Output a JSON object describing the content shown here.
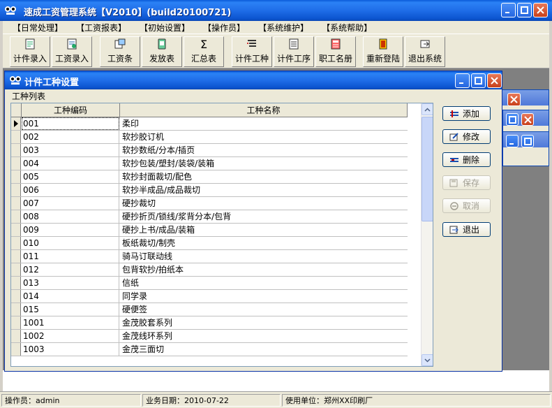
{
  "window": {
    "title": "速成工资管理系统【V2010】(build20100721)",
    "icon": "app-logo-icon"
  },
  "menu": [
    {
      "label": "【日常处理】"
    },
    {
      "label": "【工资报表】"
    },
    {
      "label": "【初始设置】"
    },
    {
      "label": "【操作员】"
    },
    {
      "label": "【系统维护】"
    },
    {
      "label": "【系统帮助】"
    }
  ],
  "toolbar": [
    {
      "label": "计件录入",
      "icon": "piece-entry-icon"
    },
    {
      "label": "工资录入",
      "icon": "salary-entry-icon"
    },
    {
      "label": "工资条",
      "icon": "payslip-icon"
    },
    {
      "label": "发放表",
      "icon": "payout-sheet-icon"
    },
    {
      "label": "汇总表",
      "icon": "sum-icon"
    },
    {
      "label": "计件工种",
      "icon": "piece-type-icon"
    },
    {
      "label": "计件工序",
      "icon": "piece-process-icon"
    },
    {
      "label": "职工名册",
      "icon": "employee-roster-icon"
    },
    {
      "label": "重新登陆",
      "icon": "relogin-icon"
    },
    {
      "label": "退出系统",
      "icon": "exit-system-icon"
    }
  ],
  "child_window": {
    "title": "计件工种设置",
    "group_label": "工种列表"
  },
  "grid": {
    "columns": [
      "工种编码",
      "工种名称"
    ],
    "rows": [
      {
        "code": "001",
        "name": "柔印"
      },
      {
        "code": "002",
        "name": "软抄胶订机"
      },
      {
        "code": "003",
        "name": "软抄数纸/分本/插页"
      },
      {
        "code": "004",
        "name": "软抄包装/塑封/装袋/装箱"
      },
      {
        "code": "005",
        "name": "软抄封面裁切/配色"
      },
      {
        "code": "006",
        "name": "软抄半成品/成品裁切"
      },
      {
        "code": "007",
        "name": "硬抄裁切"
      },
      {
        "code": "008",
        "name": "硬抄折页/锁线/浆背分本/包背"
      },
      {
        "code": "009",
        "name": "硬抄上书/成品/装箱"
      },
      {
        "code": "010",
        "name": "板纸裁切/制壳"
      },
      {
        "code": "011",
        "name": "骑马订联动线"
      },
      {
        "code": "012",
        "name": "包背软抄/拍纸本"
      },
      {
        "code": "013",
        "name": "信纸"
      },
      {
        "code": "014",
        "name": "同学录"
      },
      {
        "code": "015",
        "name": "硬便签"
      },
      {
        "code": "1001",
        "name": "金茂胶套系列"
      },
      {
        "code": "1002",
        "name": "金茂线环系列"
      },
      {
        "code": "1003",
        "name": "金茂三面切"
      }
    ]
  },
  "side_buttons": [
    {
      "label": "添加",
      "icon": "add-icon",
      "enabled": true
    },
    {
      "label": "修改",
      "icon": "edit-icon",
      "enabled": true
    },
    {
      "label": "删除",
      "icon": "delete-icon",
      "enabled": true
    },
    {
      "label": "保存",
      "icon": "save-icon",
      "enabled": false
    },
    {
      "label": "取消",
      "icon": "cancel-icon",
      "enabled": false
    },
    {
      "label": "退出",
      "icon": "exit-icon",
      "enabled": true
    }
  ],
  "status": {
    "operator": "操作员：admin",
    "business_date": "业务日期：2010-07-22",
    "org": "使用单位：郑州XX印刷厂"
  },
  "colors": {
    "title_blue": "#0a5bd9",
    "close_red": "#c8401b",
    "panel": "#ece9d8"
  }
}
